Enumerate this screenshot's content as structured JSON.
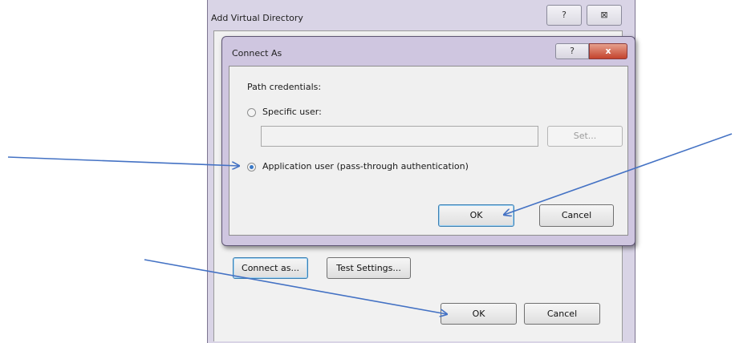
{
  "outer_dialog": {
    "title": "Add Virtual Directory",
    "help_label": "?",
    "close_label": "⊠",
    "connect_as_label": "Connect as...",
    "test_settings_label": "Test Settings...",
    "ok_label": "OK",
    "cancel_label": "Cancel"
  },
  "inner_dialog": {
    "title": "Connect As",
    "help_label": "?",
    "close_label": "x",
    "group_label": "Path credentials:",
    "specific_user_label": "Specific user:",
    "specific_user_value": "",
    "set_label": "Set...",
    "application_user_label": "Application user (pass-through authentication)",
    "selected_option": "application_user",
    "ok_label": "OK",
    "cancel_label": "Cancel"
  },
  "annotations": {
    "arrow_color": "#4472c4"
  }
}
